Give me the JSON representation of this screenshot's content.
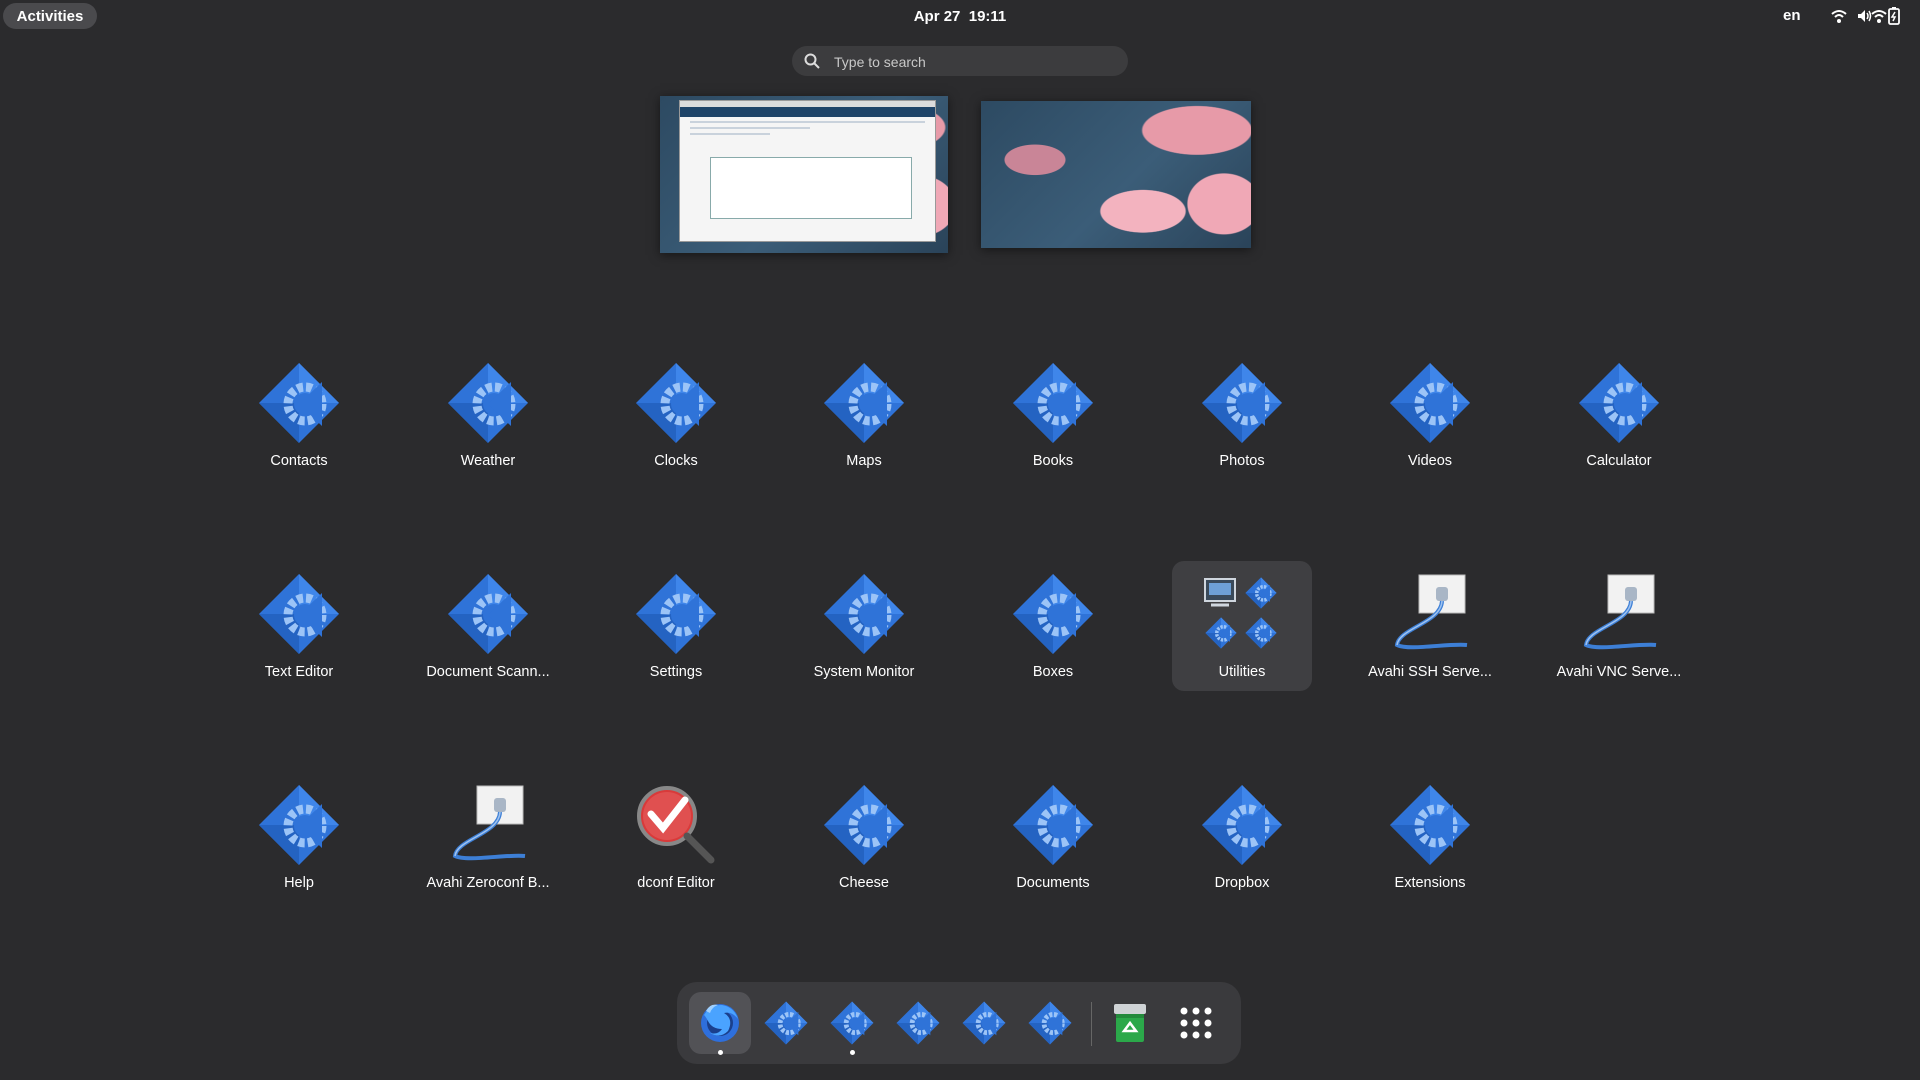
{
  "topbar": {
    "activities_label": "Activities",
    "clock": "Apr 27  19:11",
    "language": "en",
    "tray_icons": [
      "wifi-icon",
      "volume-icon",
      "battery-icon"
    ]
  },
  "search": {
    "placeholder": "Type to search"
  },
  "workspaces": [
    "workspace-1",
    "workspace-2"
  ],
  "apps": [
    {
      "label": "Contacts",
      "icon": "gear-diamond-icon"
    },
    {
      "label": "Weather",
      "icon": "gear-diamond-icon"
    },
    {
      "label": "Clocks",
      "icon": "gear-diamond-icon"
    },
    {
      "label": "Maps",
      "icon": "gear-diamond-icon"
    },
    {
      "label": "Books",
      "icon": "gear-diamond-icon"
    },
    {
      "label": "Photos",
      "icon": "gear-diamond-icon"
    },
    {
      "label": "Videos",
      "icon": "gear-diamond-icon"
    },
    {
      "label": "Calculator",
      "icon": "gear-diamond-icon"
    },
    {
      "label": "Text Editor",
      "icon": "gear-diamond-icon"
    },
    {
      "label": "Document Scann...",
      "icon": "gear-diamond-icon"
    },
    {
      "label": "Settings",
      "icon": "gear-diamond-icon"
    },
    {
      "label": "System Monitor",
      "icon": "gear-diamond-icon"
    },
    {
      "label": "Boxes",
      "icon": "gear-diamond-icon"
    },
    {
      "label": "Utilities",
      "icon": "folder-icon"
    },
    {
      "label": "Avahi SSH Serve...",
      "icon": "network-plug-icon"
    },
    {
      "label": "Avahi VNC Serve...",
      "icon": "network-plug-icon"
    },
    {
      "label": "Help",
      "icon": "gear-diamond-icon"
    },
    {
      "label": "Avahi Zeroconf B...",
      "icon": "network-plug-icon"
    },
    {
      "label": "dconf Editor",
      "icon": "magnifier-check-icon"
    },
    {
      "label": "Cheese",
      "icon": "gear-diamond-icon"
    },
    {
      "label": "Documents",
      "icon": "gear-diamond-icon"
    },
    {
      "label": "Dropbox",
      "icon": "gear-diamond-icon"
    },
    {
      "label": "Extensions",
      "icon": "gear-diamond-icon"
    }
  ],
  "dock": [
    {
      "icon": "firefox-icon",
      "running": true,
      "active": true
    },
    {
      "icon": "gear-diamond-icon",
      "running": false
    },
    {
      "icon": "gear-diamond-icon",
      "running": true
    },
    {
      "icon": "gear-diamond-icon",
      "running": false
    },
    {
      "icon": "gear-diamond-icon",
      "running": false
    },
    {
      "icon": "gear-diamond-icon",
      "running": false
    },
    {
      "icon": "trash-icon",
      "running": false
    },
    {
      "icon": "app-grid-icon",
      "running": false
    }
  ],
  "colors": {
    "background": "#2b2b2d",
    "accent_blue": "#2f73d8",
    "folder_bg": "#3f3f42"
  }
}
